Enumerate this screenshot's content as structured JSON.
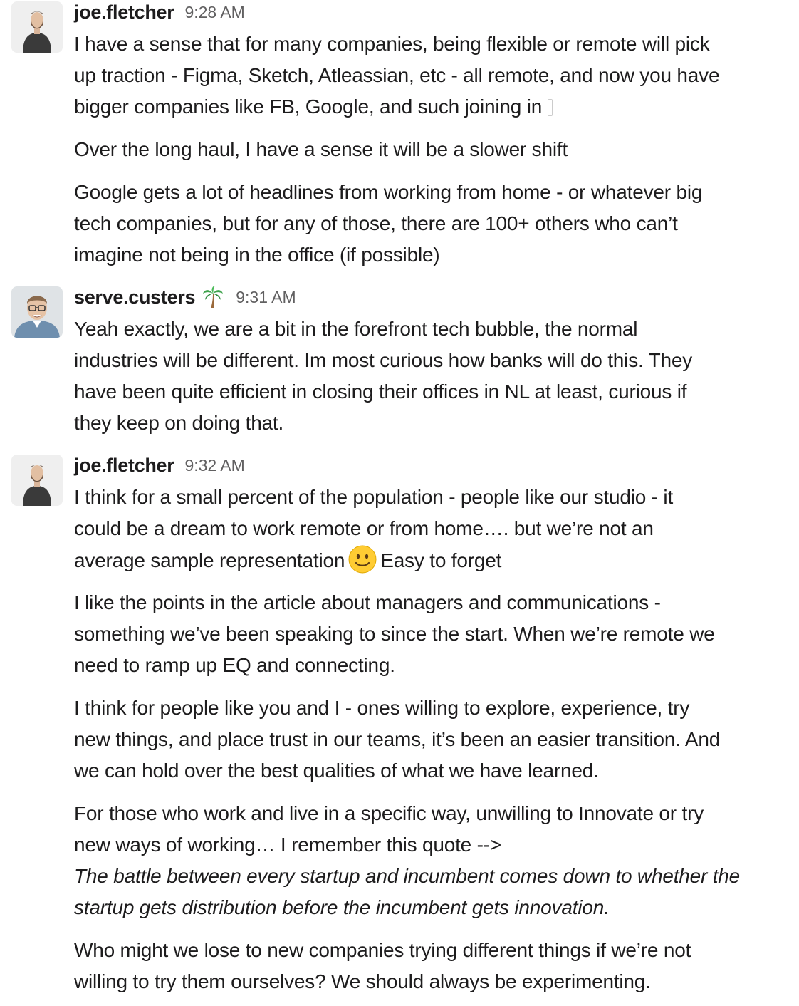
{
  "messages": [
    {
      "sender": "joe.fletcher",
      "time": "9:28 AM",
      "avatar_icon": "man-dark-sweater-avatar",
      "paragraphs": [
        {
          "lines": [
            "I have a sense that for many companies, being flexible or remote will pick",
            "up traction - Figma, Sketch, Atleassian, etc - all remote, and now you have",
            "bigger companies like FB, Google, and such joining in"
          ]
        },
        {
          "lines": [
            "Over the long haul, I have a sense it will be a slower shift"
          ]
        },
        {
          "lines": [
            "Google gets a lot of headlines from working from home - or whatever big",
            "tech companies, but for any of those, there are 100+ others who can’t",
            "imagine not being in the office (if possible)"
          ]
        }
      ]
    },
    {
      "sender": "serve.custers",
      "time": "9:31 AM",
      "status_emoji": "palm-tree-icon",
      "avatar_icon": "man-glasses-avatar",
      "paragraphs": [
        {
          "lines": [
            "Yeah exactly, we are a bit in the forefront tech bubble, the normal",
            "industries will be different. Im most curious how banks will do this. They",
            "have been quite efficient in closing their offices in NL at least, curious if",
            "they keep on doing that."
          ]
        }
      ]
    },
    {
      "sender": "joe.fletcher",
      "time": "9:32 AM",
      "avatar_icon": "man-dark-sweater-avatar",
      "paragraphs": [
        {
          "lines": [
            "I think for a small percent of the population - people like our studio - it",
            "could be a dream to work remote or from home…. but we’re not an"
          ],
          "line3_before": "average sample representation",
          "line3_emoji": "slightly-smiling-face-icon",
          "line3_after": "Easy to forget"
        },
        {
          "lines": [
            "I like the points in the article about managers and communications -",
            "something we’ve been speaking to since the start. When we’re remote we",
            "need to ramp up EQ and connecting."
          ]
        },
        {
          "lines": [
            "I think for people like you and I - ones willing to explore, experience,  try",
            "new things, and place trust in our teams, it’s been an easier transition. And",
            "we can hold over the best qualities of what we have learned."
          ]
        },
        {
          "lines": [
            "For those who work and live in a specific way, unwilling to Innovate or try",
            "new ways of working… I remember this quote -->"
          ],
          "italic_lines": [
            "The battle between every startup and incumbent comes down to whether the",
            "startup gets distribution before the incumbent gets innovation."
          ]
        },
        {
          "lines": [
            "Who might we lose to new companies trying different things if we’re not",
            "willing to try them ourselves? We should always be experimenting."
          ]
        }
      ]
    }
  ]
}
